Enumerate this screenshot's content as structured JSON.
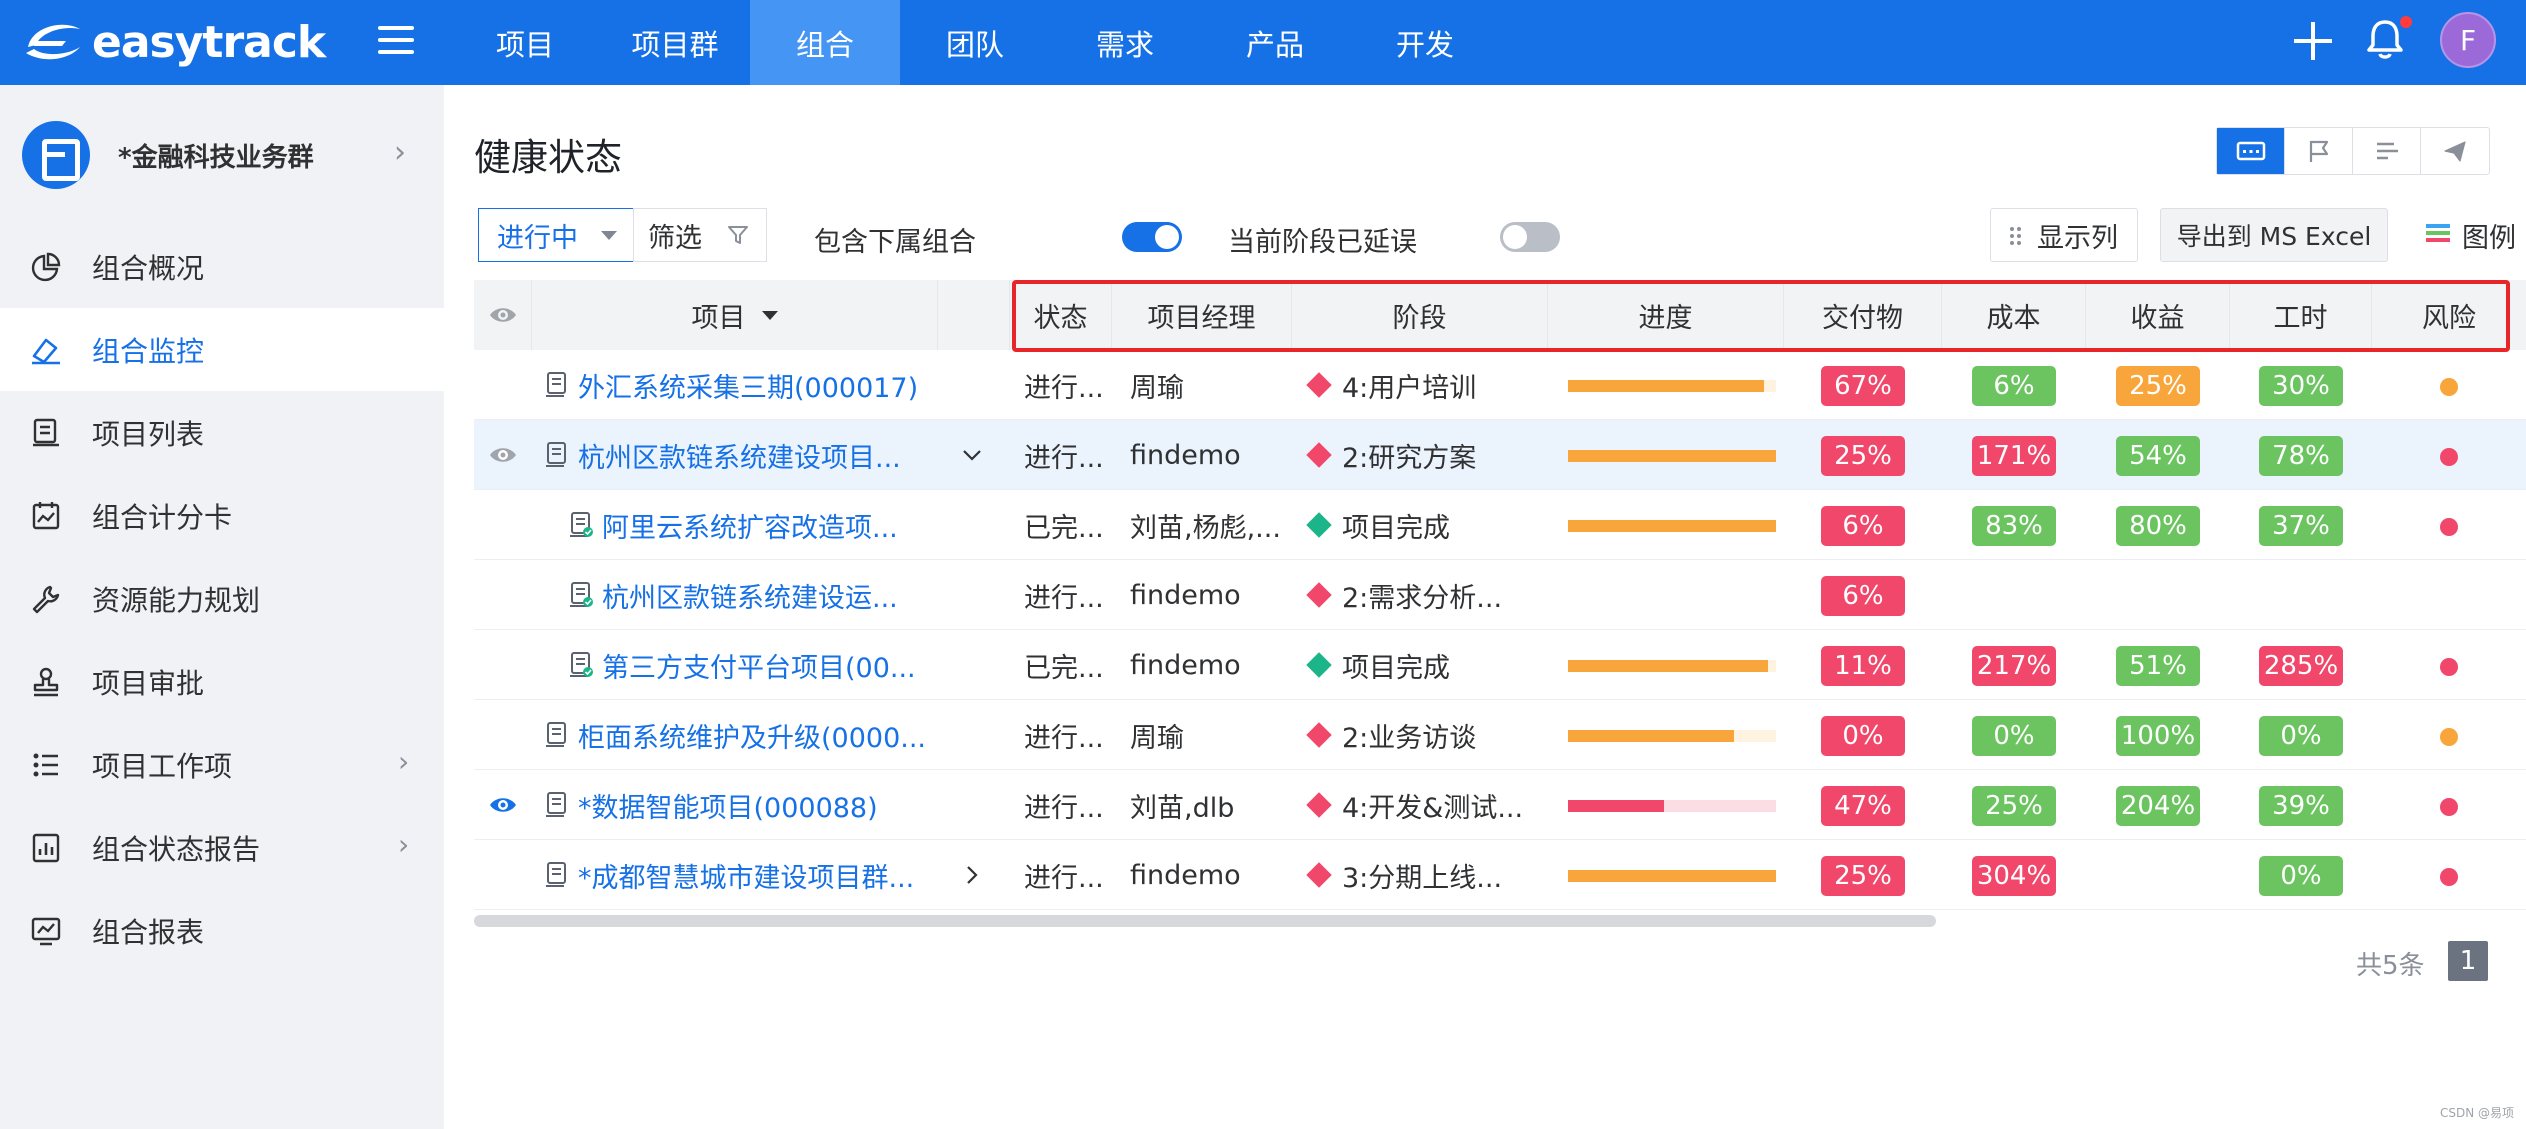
{
  "brand": {
    "name": "easytrack"
  },
  "nav": {
    "items": [
      "项目",
      "项目群",
      "组合",
      "团队",
      "需求",
      "产品",
      "开发"
    ],
    "active_index": 2
  },
  "user": {
    "avatar_letter": "F"
  },
  "sidebar": {
    "group_name": "*金融科技业务群",
    "items": [
      {
        "label": "组合概况",
        "icon": "pie-chart-icon",
        "active": false,
        "has_children": false
      },
      {
        "label": "组合监控",
        "icon": "monitor-icon",
        "active": true,
        "has_children": false
      },
      {
        "label": "项目列表",
        "icon": "project-list-icon",
        "active": false,
        "has_children": false
      },
      {
        "label": "组合计分卡",
        "icon": "scorecard-icon",
        "active": false,
        "has_children": false
      },
      {
        "label": "资源能力规划",
        "icon": "wrench-icon",
        "active": false,
        "has_children": false
      },
      {
        "label": "项目审批",
        "icon": "approval-stamp-icon",
        "active": false,
        "has_children": false
      },
      {
        "label": "项目工作项",
        "icon": "list-icon",
        "active": false,
        "has_children": true
      },
      {
        "label": "组合状态报告",
        "icon": "report-icon",
        "active": false,
        "has_children": true
      },
      {
        "label": "组合报表",
        "icon": "chart-board-icon",
        "active": false,
        "has_children": false
      }
    ]
  },
  "main": {
    "title": "健康状态",
    "filters": {
      "status_value": "进行中",
      "filter_label": "筛选",
      "include_sub_label": "包含下属组合",
      "include_sub_on": true,
      "delayed_label": "当前阶段已延误",
      "delayed_on": false,
      "columns_label": "显示列",
      "export_label": "导出到 MS Excel",
      "legend_label": "图例"
    },
    "table": {
      "headers": {
        "project": "项目",
        "status": "状态",
        "manager": "项目经理",
        "stage": "阶段",
        "progress": "进度",
        "deliverable": "交付物",
        "cost": "成本",
        "revenue": "收益",
        "hours": "工时",
        "risk": "风险"
      },
      "rows": [
        {
          "name": "外汇系统采集三期(000017)",
          "eye": "none",
          "indent": 0,
          "expander": "",
          "status": "进行...",
          "manager": "周瑜",
          "stage": "4:用户培训",
          "stage_color": "#f0476b",
          "progress": 0.94,
          "progress_color": "#f8a53c",
          "progress_track": "#fdf3e0",
          "deliverable": {
            "v": "67%",
            "c": "#f0476b"
          },
          "cost": {
            "v": "6%",
            "c": "#6cc461"
          },
          "revenue": {
            "v": "25%",
            "c": "#f8a53c"
          },
          "hours": {
            "v": "30%",
            "c": "#6cc461"
          },
          "risk": "#f8a53c",
          "highlight": false
        },
        {
          "name": "杭州区款链系统建设项目...",
          "eye": "grey",
          "indent": 0,
          "expander": "down",
          "status": "进行...",
          "manager": "findemo",
          "stage": "2:研究方案",
          "stage_color": "#f0476b",
          "progress": 1.0,
          "progress_color": "#f8a53c",
          "progress_track": "#fdf3e0",
          "deliverable": {
            "v": "25%",
            "c": "#f0476b"
          },
          "cost": {
            "v": "171%",
            "c": "#f0476b"
          },
          "revenue": {
            "v": "54%",
            "c": "#6cc461"
          },
          "hours": {
            "v": "78%",
            "c": "#6cc461"
          },
          "risk": "#f0476b",
          "highlight": true
        },
        {
          "name": "阿里云系统扩容改造项...",
          "eye": "none",
          "indent": 1,
          "expander": "",
          "status": "已完...",
          "manager": "刘苗,杨彪,...",
          "stage": "项目完成",
          "stage_color": "#1bb589",
          "progress": 1.0,
          "progress_color": "#f8a53c",
          "progress_track": "#fdf3e0",
          "deliverable": {
            "v": "6%",
            "c": "#f0476b"
          },
          "cost": {
            "v": "83%",
            "c": "#6cc461"
          },
          "revenue": {
            "v": "80%",
            "c": "#6cc461"
          },
          "hours": {
            "v": "37%",
            "c": "#6cc461"
          },
          "risk": "#f0476b",
          "highlight": false
        },
        {
          "name": "杭州区款链系统建设运...",
          "eye": "none",
          "indent": 1,
          "expander": "",
          "status": "进行...",
          "manager": "findemo",
          "stage": "2:需求分析...",
          "stage_color": "#f0476b",
          "progress": null,
          "progress_color": "#f8a53c",
          "progress_track": "#fdf3e0",
          "deliverable": {
            "v": "6%",
            "c": "#f0476b"
          },
          "cost": null,
          "revenue": null,
          "hours": null,
          "risk": null,
          "highlight": false
        },
        {
          "name": "第三方支付平台项目(00...",
          "eye": "none",
          "indent": 1,
          "expander": "",
          "status": "已完...",
          "manager": "findemo",
          "stage": "项目完成",
          "stage_color": "#1bb589",
          "progress": 0.96,
          "progress_color": "#f8a53c",
          "progress_track": "#fdf3e0",
          "deliverable": {
            "v": "11%",
            "c": "#f0476b"
          },
          "cost": {
            "v": "217%",
            "c": "#f0476b"
          },
          "revenue": {
            "v": "51%",
            "c": "#6cc461"
          },
          "hours": {
            "v": "285%",
            "c": "#f0476b"
          },
          "risk": "#f0476b",
          "highlight": false
        },
        {
          "name": "柜面系统维护及升级(0000...",
          "eye": "none",
          "indent": 0,
          "expander": "",
          "status": "进行...",
          "manager": "周瑜",
          "stage": "2:业务访谈",
          "stage_color": "#f0476b",
          "progress": 0.8,
          "progress_color": "#f8a53c",
          "progress_track": "#fdf3e0",
          "deliverable": {
            "v": "0%",
            "c": "#f0476b"
          },
          "cost": {
            "v": "0%",
            "c": "#6cc461"
          },
          "revenue": {
            "v": "100%",
            "c": "#6cc461"
          },
          "hours": {
            "v": "0%",
            "c": "#6cc461"
          },
          "risk": "#f8a53c",
          "highlight": false
        },
        {
          "name": "*数据智能项目(000088)",
          "eye": "blue",
          "indent": 0,
          "expander": "",
          "status": "进行...",
          "manager": "刘苗,dlb",
          "stage": "4:开发&测试...",
          "stage_color": "#f0476b",
          "progress": 0.46,
          "progress_color": "#f0476b",
          "progress_track": "#fbdde3",
          "deliverable": {
            "v": "47%",
            "c": "#f0476b"
          },
          "cost": {
            "v": "25%",
            "c": "#6cc461"
          },
          "revenue": {
            "v": "204%",
            "c": "#6cc461"
          },
          "hours": {
            "v": "39%",
            "c": "#6cc461"
          },
          "risk": "#f0476b",
          "highlight": false
        },
        {
          "name": "*成都智慧城市建设项目群...",
          "eye": "none",
          "indent": 0,
          "expander": "right",
          "status": "进行...",
          "manager": "findemo",
          "stage": "3:分期上线...",
          "stage_color": "#f0476b",
          "progress": 1.0,
          "progress_color": "#f8a53c",
          "progress_track": "#fdf3e0",
          "deliverable": {
            "v": "25%",
            "c": "#f0476b"
          },
          "cost": {
            "v": "304%",
            "c": "#f0476b"
          },
          "revenue": null,
          "hours": {
            "v": "0%",
            "c": "#6cc461"
          },
          "risk": "#f0476b",
          "highlight": false
        }
      ]
    },
    "pagination": {
      "total_text": "共5条",
      "current_page": "1"
    }
  },
  "watermark": "CSDN @易项"
}
